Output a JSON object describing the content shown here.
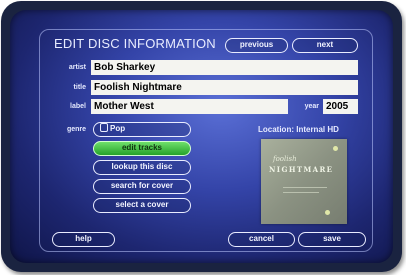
{
  "screen": {
    "title": "EDIT DISC INFORMATION",
    "nav": {
      "previous": "previous",
      "next": "next"
    }
  },
  "form": {
    "artist": {
      "label": "artist",
      "value": "Bob Sharkey"
    },
    "title": {
      "label": "title",
      "value": "Foolish Nightmare"
    },
    "label": {
      "label": "label",
      "value": "Mother West"
    },
    "year": {
      "label": "year",
      "value": "2005"
    },
    "genre": {
      "label": "genre",
      "value": "Pop"
    }
  },
  "actions": {
    "edit_tracks": "edit tracks",
    "lookup_disc": "lookup this disc",
    "search_cover": "search for cover",
    "select_cover": "select a cover"
  },
  "location": "Location: Internal HD",
  "cover": {
    "script": "foolish",
    "title": "NIGHTMARE"
  },
  "footer": {
    "help": "help",
    "cancel": "cancel",
    "save": "save"
  },
  "colors": {
    "background": "#3444a8",
    "accent_green": "#25a22a",
    "field": "#f4f4f0"
  },
  "icons": {
    "genre": "genre-tag-icon"
  }
}
